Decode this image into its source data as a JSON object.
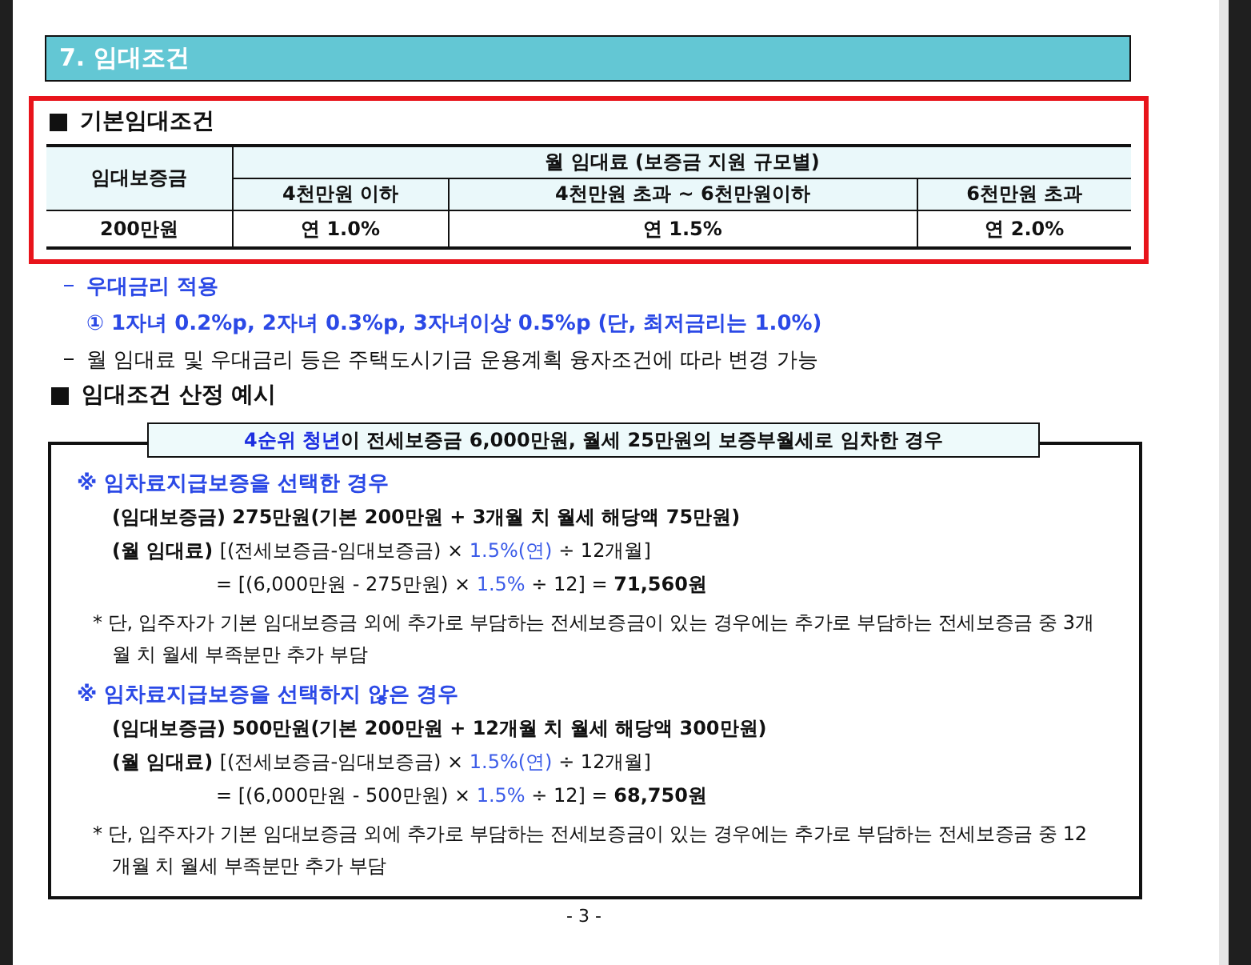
{
  "section_header": "7. 임대조건",
  "basic_terms": {
    "title": "기본임대조건",
    "highlighted": true,
    "table": {
      "deposit_header": "임대보증금",
      "rent_header": "월 임대료 (보증금 지원 규모별)",
      "rent_columns": [
        "4천만원 이하",
        "4천만원 초과 ~ 6천만원이하",
        "6천만원 초과"
      ],
      "row": {
        "deposit": "200만원",
        "rates": [
          "연 1.0%",
          "연 1.5%",
          "연 2.0%"
        ]
      }
    }
  },
  "notes": [
    {
      "kind": "emphasis-dash",
      "text": "우대금리 적용"
    },
    {
      "kind": "emphasis-sub",
      "text": "① 1자녀 0.2%p, 2자녀 0.3%p, 3자녀이상 0.5%p (단, 최저금리는 1.0%)"
    },
    {
      "kind": "dash",
      "text": "월 임대료 및 우대금리 등은 주택도시기금 운용계획 융자조건에 따라 변경 가능"
    }
  ],
  "example": {
    "title": "임대조건 산정 예시",
    "caption": [
      {
        "text": "4순위 청년",
        "kind": "emphasis"
      },
      {
        "text": "이 전세보증금 6,000만원, 월세 25만원의 보증부월세로 임차한 경우",
        "kind": "strong"
      }
    ],
    "cases": [
      {
        "heading": "※ 임차료지급보증을 선택한 경우",
        "lines": [
          {
            "kind": "line",
            "segments": [
              {
                "text": "(임대보증금) 275만원(기본 200만원 + 3개월 치 월세 해당액 75만원)",
                "kind": "strong"
              }
            ]
          },
          {
            "kind": "line",
            "segments": [
              {
                "text": "(월 임대료) ",
                "kind": "strong"
              },
              {
                "text": "[(전세보증금-임대보증금) × ",
                "kind": "plain"
              },
              {
                "text": "1.5%(연)",
                "kind": "accent"
              },
              {
                "text": " ÷ 12개월]",
                "kind": "plain"
              }
            ]
          },
          {
            "kind": "continuation",
            "segments": [
              {
                "text": "= [(6,000만원 - 275만원) × ",
                "kind": "plain"
              },
              {
                "text": "1.5%",
                "kind": "accent"
              },
              {
                "text": " ÷ 12] = ",
                "kind": "plain"
              },
              {
                "text": "71,560원",
                "kind": "strong"
              }
            ]
          }
        ],
        "footnote": "* 단, 입주자가 기본 임대보증금 외에 추가로 부담하는 전세보증금이 있는 경우에는 추가로 부담하는 전세보증금 중 3개월 치 월세 부족분만 추가 부담"
      },
      {
        "heading": "※ 임차료지급보증을 선택하지 않은 경우",
        "lines": [
          {
            "kind": "line",
            "segments": [
              {
                "text": "(임대보증금) 500만원(기본 200만원 + 12개월 치 월세 해당액 300만원)",
                "kind": "strong"
              }
            ]
          },
          {
            "kind": "line",
            "segments": [
              {
                "text": "(월 임대료) ",
                "kind": "strong"
              },
              {
                "text": "[(전세보증금-임대보증금) × ",
                "kind": "plain"
              },
              {
                "text": "1.5%(연)",
                "kind": "accent"
              },
              {
                "text": " ÷ 12개월]",
                "kind": "plain"
              }
            ]
          },
          {
            "kind": "continuation",
            "segments": [
              {
                "text": "= [(6,000만원 - 500만원) × ",
                "kind": "plain"
              },
              {
                "text": "1.5%",
                "kind": "accent"
              },
              {
                "text": " ÷ 12] = ",
                "kind": "plain"
              },
              {
                "text": "68,750원",
                "kind": "strong"
              }
            ]
          }
        ],
        "footnote": "* 단, 입주자가 기본 임대보증금 외에 추가로 부담하는 전세보증금이 있는 경우에는 추가로 부담하는 전세보증금 중 12개월 치 월세 부족분만 추가 부담"
      }
    ]
  },
  "page_number": "- 3 -"
}
